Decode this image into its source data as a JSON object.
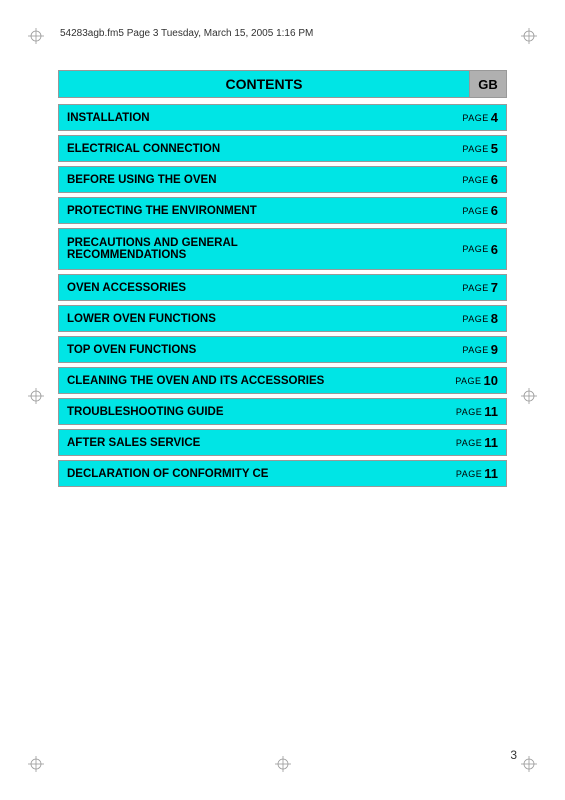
{
  "printInfo": "54283agb.fm5  Page 3  Tuesday, March 15, 2005  1:16 PM",
  "header": {
    "title": "CONTENTS",
    "badge": "GB"
  },
  "tocItems": [
    {
      "id": "installation",
      "label": "INSTALLATION",
      "page": "4",
      "tall": false
    },
    {
      "id": "electrical",
      "label": "ELECTRICAL CONNECTION",
      "page": "5",
      "tall": false
    },
    {
      "id": "before-oven",
      "label": "BEFORE USING THE OVEN",
      "page": "6",
      "tall": false
    },
    {
      "id": "protecting",
      "label": "PROTECTING THE ENVIRONMENT",
      "page": "6",
      "tall": false
    },
    {
      "id": "precautions",
      "label": "PRECAUTIONS AND GENERAL\nRECOMMENDATIONS",
      "page": "6",
      "tall": true
    },
    {
      "id": "accessories",
      "label": "OVEN ACCESSORIES",
      "page": "7",
      "tall": false
    },
    {
      "id": "lower-functions",
      "label": "LOWER OVEN FUNCTIONS",
      "page": "8",
      "tall": false
    },
    {
      "id": "top-functions",
      "label": "TOP OVEN FUNCTIONS",
      "page": "9",
      "tall": false
    },
    {
      "id": "cleaning",
      "label": "CLEANING THE OVEN AND ITS ACCESSORIES",
      "page": "10",
      "tall": false
    },
    {
      "id": "troubleshooting",
      "label": "TROUBLESHOOTING GUIDE",
      "page": "11",
      "tall": false
    },
    {
      "id": "after-sales",
      "label": "AFTER SALES SERVICE",
      "page": "11",
      "tall": false
    },
    {
      "id": "declaration",
      "label": "DECLARATION OF CONFORMITY CE",
      "page": "11",
      "tall": false
    }
  ],
  "pageNumber": "3"
}
